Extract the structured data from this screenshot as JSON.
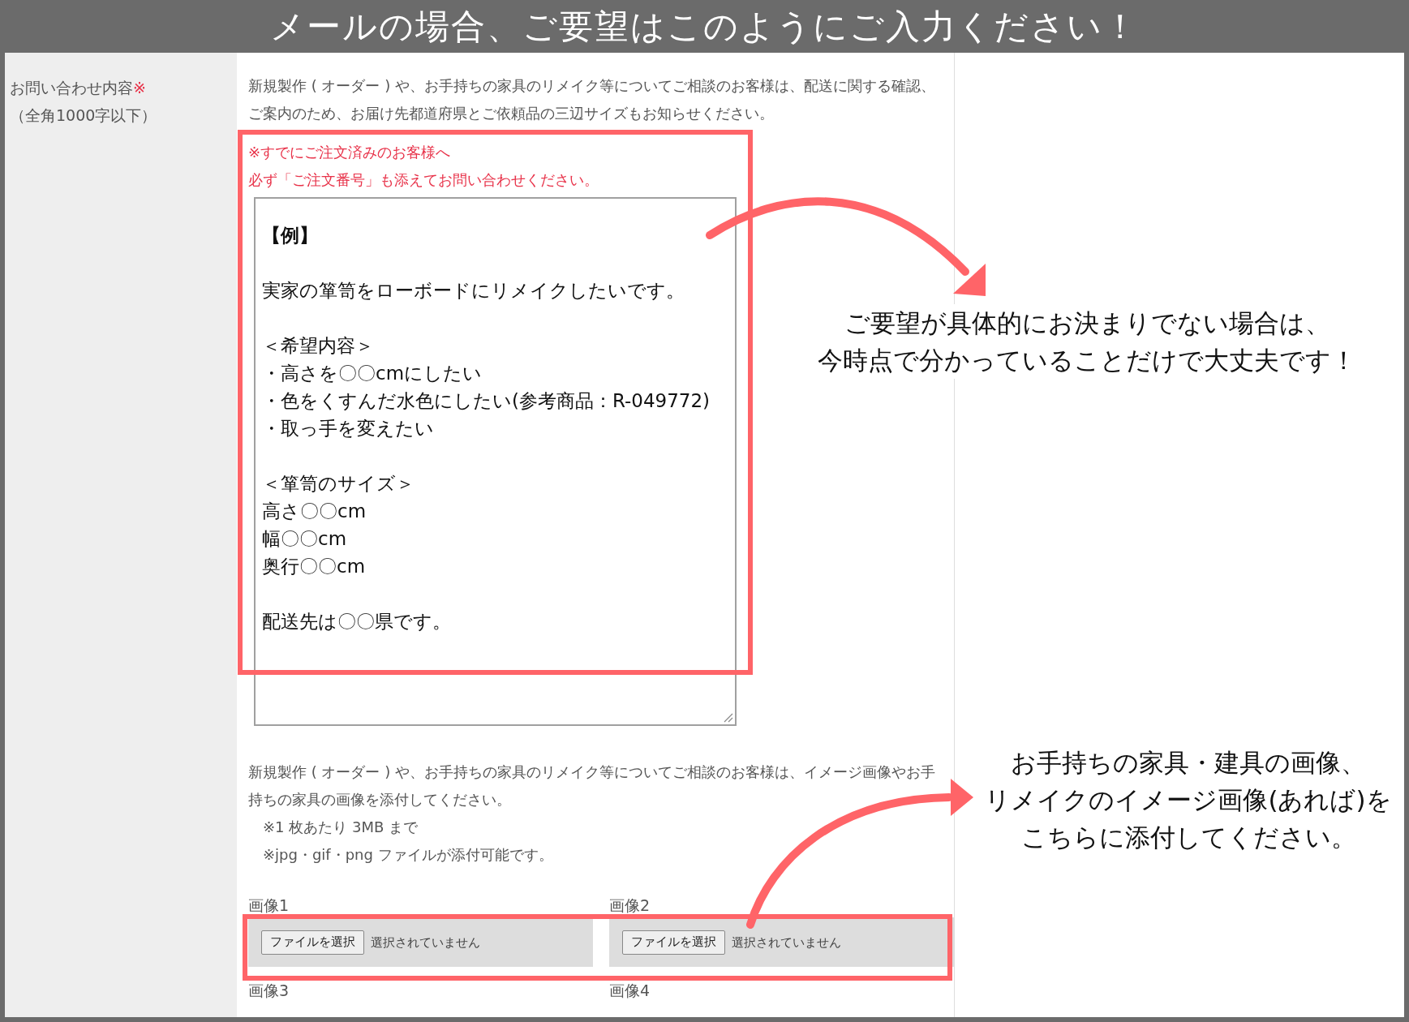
{
  "banner": {
    "title": "メールの場合、ご要望はこのようにご入力ください！"
  },
  "form": {
    "label": "お問い合わせ内容",
    "required_mark": "※",
    "limit": "（全角1000字以下）",
    "intro": "新規製作 ( オーダー ) や、お手持ちの家具のリメイク等についてご相談のお客様は、配送に関する確認、ご案内のため、お届け先都道府県とご依頼品の三辺サイズもお知らせください。",
    "notice": [
      "※すでにご注文済みのお客様へ",
      "必ず「ご注文番号」も添えてお問い合わせください。"
    ],
    "message": {
      "paragraphs": [
        {
          "kind": "heading",
          "lines": [
            "【例】"
          ]
        },
        {
          "kind": "text",
          "lines": [
            "実家の箪笥をローボードにリメイクしたいです。"
          ]
        },
        {
          "kind": "text",
          "lines": [
            "＜希望内容＞",
            "・高さを〇〇cmにしたい",
            "・色をくすんだ水色にしたい(参考商品：R-049772)",
            "・取っ手を変えたい"
          ]
        },
        {
          "kind": "text",
          "lines": [
            "＜箪笥のサイズ＞",
            "高さ〇〇cm",
            "幅〇〇cm",
            "奥行〇〇cm"
          ]
        },
        {
          "kind": "text",
          "lines": [
            "配送先は〇〇県です。"
          ]
        }
      ]
    },
    "attach_intro": "新規製作 ( オーダー ) や、お手持ちの家具のリメイク等についてご相談のお客様は、イメージ画像やお手持ちの家具の画像を添付してください。",
    "attach_notes": [
      "※1 枚あたり 3MB まで",
      "※jpg・gif・png ファイルが添付可能です。"
    ],
    "images": [
      {
        "label": "画像1",
        "button": "ファイルを選択",
        "status": "選択されていません"
      },
      {
        "label": "画像2",
        "button": "ファイルを選択",
        "status": "選択されていません"
      }
    ],
    "more_images": [
      "画像3",
      "画像4"
    ]
  },
  "callouts": [
    {
      "lines": [
        "ご要望が具体的にお決まりでない場合は、",
        "今時点で分かっていることだけで大丈夫です！"
      ]
    },
    {
      "lines": [
        "お手持ちの家具・建具の画像、",
        "リメイクのイメージ画像(あれば)を",
        "こちらに添付してください。"
      ]
    }
  ]
}
